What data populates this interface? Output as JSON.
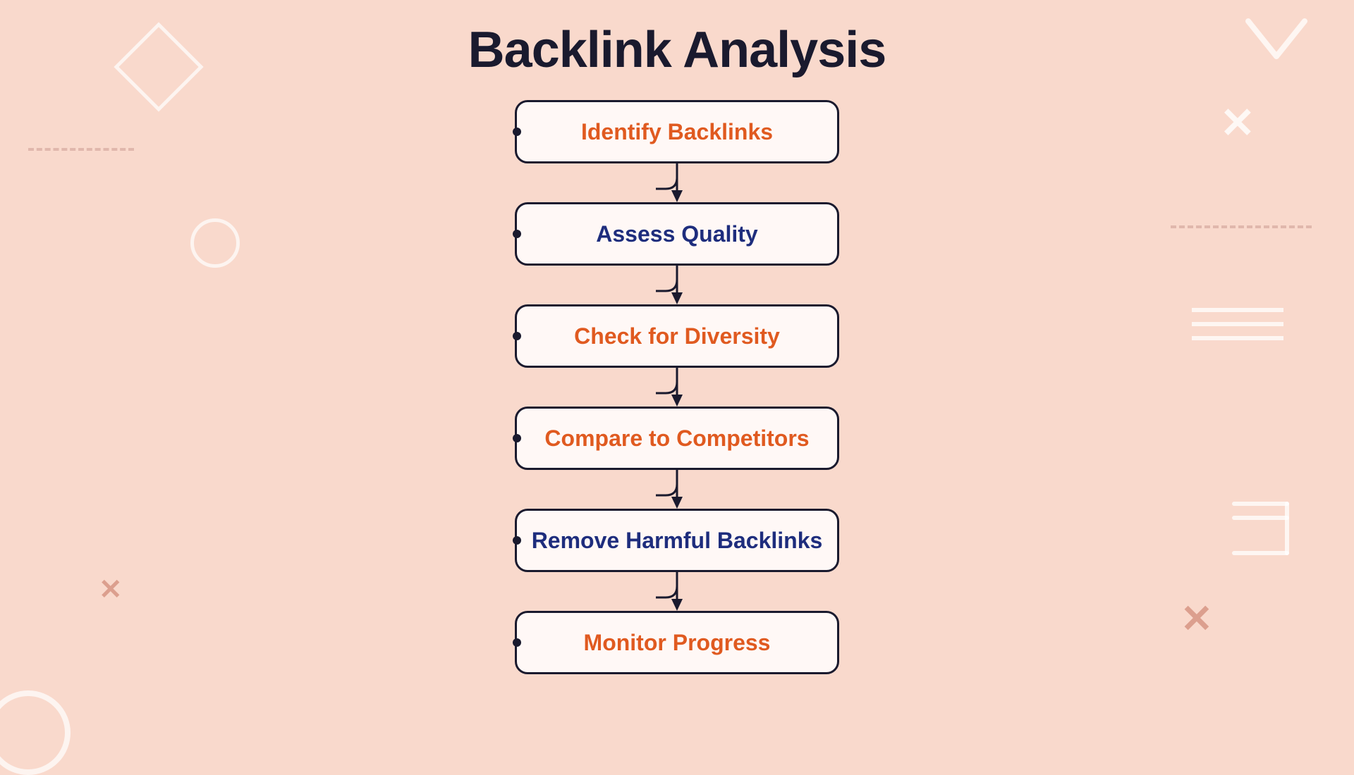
{
  "page": {
    "title": "Backlink Analysis",
    "background_color": "#f9d9cc"
  },
  "flow": {
    "items": [
      {
        "label": "Identify Backlinks",
        "color_class": "color-orange"
      },
      {
        "label": "Assess Quality",
        "color_class": "color-navy"
      },
      {
        "label": "Check for Diversity",
        "color_class": "color-orange"
      },
      {
        "label": "Compare to Competitors",
        "color_class": "color-orange"
      },
      {
        "label": "Remove Harmful Backlinks",
        "color_class": "color-navy"
      },
      {
        "label": "Monitor Progress",
        "color_class": "color-orange"
      }
    ]
  },
  "decorations": {
    "x_symbol": "✕",
    "diamond_border_color": "rgba(255,255,255,0.7)",
    "deco_color": "rgba(200,120,100,0.6)"
  }
}
